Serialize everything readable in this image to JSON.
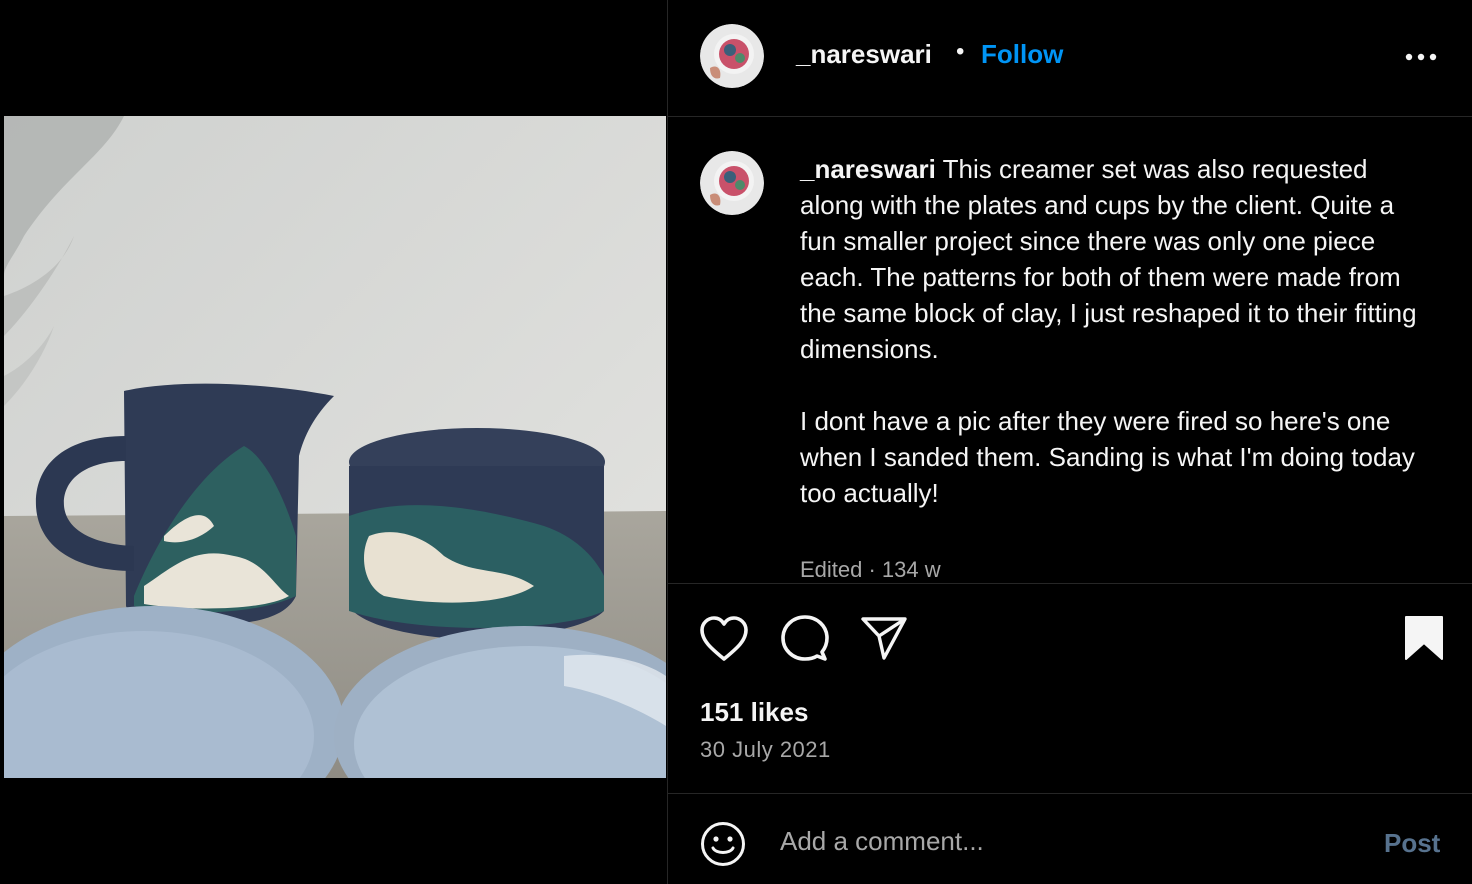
{
  "post": {
    "username": "_nareswari",
    "separator": "•",
    "follow_label": "Follow",
    "caption": "This creamer set was also requested along with the plates and cups by the client. Quite a fun smaller project since there was only one piece each. The patterns for both of them were made from the same block of clay, I just reshaped it to their fitting dimensions.\n\nI dont have a pic after they were fired so here's one when I sanded them. Sanding is what I'm doing today too actually!",
    "edited_label": "Edited · 134 w",
    "likes": "151 likes",
    "date": "30 July 2021"
  },
  "comment": {
    "placeholder": "Add a comment...",
    "post_label": "Post"
  },
  "icons": {
    "more": "more-options-icon",
    "like": "heart-icon",
    "comment": "comment-bubble-icon",
    "share": "paper-plane-icon",
    "save": "bookmark-filled-icon",
    "emoji": "emoji-smiley-icon"
  },
  "colors": {
    "background": "#000000",
    "text": "#f5f5f5",
    "secondary_text": "#a8a8a8",
    "follow": "#0095f6",
    "post_disabled": "#57728e",
    "divider": "#262626"
  }
}
